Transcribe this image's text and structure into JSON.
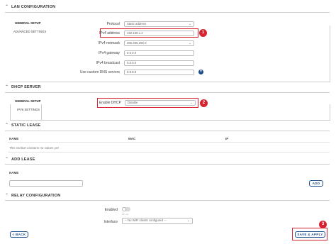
{
  "lan": {
    "title": "LAN CONFIGURATION",
    "tabs": [
      "GENERAL SETUP",
      "ADVANCED SETTINGS"
    ],
    "fields": [
      {
        "label": "Protocol",
        "value": "Static address"
      },
      {
        "label": "IPv4 address",
        "value": "192.168.1.2"
      },
      {
        "label": "IPv4 netmask",
        "value": "255.255.255.0"
      },
      {
        "label": "IPv4 gateway",
        "value": "0.0.0.0"
      },
      {
        "label": "IPv4 broadcast",
        "value": "0.0.0.0"
      },
      {
        "label": "Use custom DNS servers",
        "value": "8.8.8.8"
      }
    ]
  },
  "dhcp": {
    "title": "DHCP SERVER",
    "tabs": [
      "GENERAL SETUP",
      "IPV6 SETTINGS"
    ],
    "enable_label": "Enable DHCP",
    "enable_value": "Disable"
  },
  "static_lease": {
    "title": "STATIC LEASE",
    "columns": [
      "NAME",
      "MAC",
      "IP"
    ],
    "empty_text": "This section contains no values yet"
  },
  "add_lease": {
    "title": "ADD LEASE",
    "name_label": "NAME",
    "add_button": "ADD"
  },
  "relay": {
    "title": "RELAY CONFIGURATION",
    "enabled_label": "Enabled",
    "toggle_text": "off - on",
    "interface_label": "Interface",
    "interface_value": "-- No WiFi clients configured --"
  },
  "footer": {
    "back_button": "< BACK",
    "save_button": "SAVE & APPLY"
  },
  "badges": [
    "1",
    "2",
    "3"
  ]
}
